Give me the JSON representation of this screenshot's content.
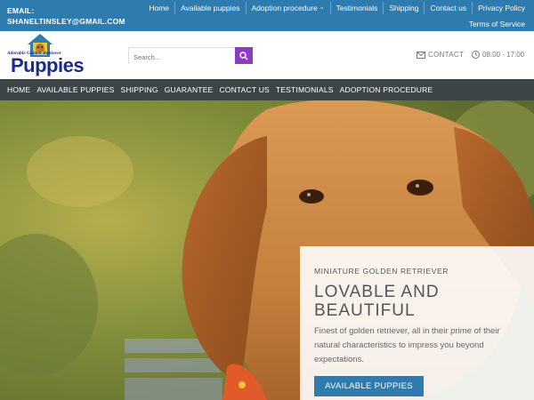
{
  "topbar": {
    "email_label": "EMAIL:",
    "email": "SHANELTINSLEY@GMAIL.COM",
    "nav": [
      "Home",
      "Available puppies",
      "Adoption procedure",
      "Testimonials",
      "Shipping",
      "Contact us",
      "Privacy Policy"
    ],
    "terms": "Terms of Service"
  },
  "logo": {
    "tagline": "Adorable Golden Retriever",
    "brand": "Puppies"
  },
  "search": {
    "placeholder": "Search..."
  },
  "header": {
    "contact": "CONTACT",
    "hours": "08:00 - 17:00"
  },
  "mainnav": [
    "HOME",
    "AVAILABLE PUPPIES",
    "SHIPPING",
    "GUARANTEE",
    "CONTACT US",
    "TESTIMONIALS",
    "ADOPTION PROCEDURE"
  ],
  "hero": {
    "eyebrow": "MINIATURE GOLDEN RETRIEVER",
    "headline": "LOVABLE AND BEAUTIFUL",
    "description": "Finest of golden retriever, all in their prime of their natural characteristics to impress you beyond expectations.",
    "cta": "AVAILABLE PUPPIES"
  },
  "colors": {
    "topbar": "#2e7bb0",
    "nav": "#3e4548",
    "search_button": "#8b3dc1",
    "cta": "#2e7bb0"
  }
}
